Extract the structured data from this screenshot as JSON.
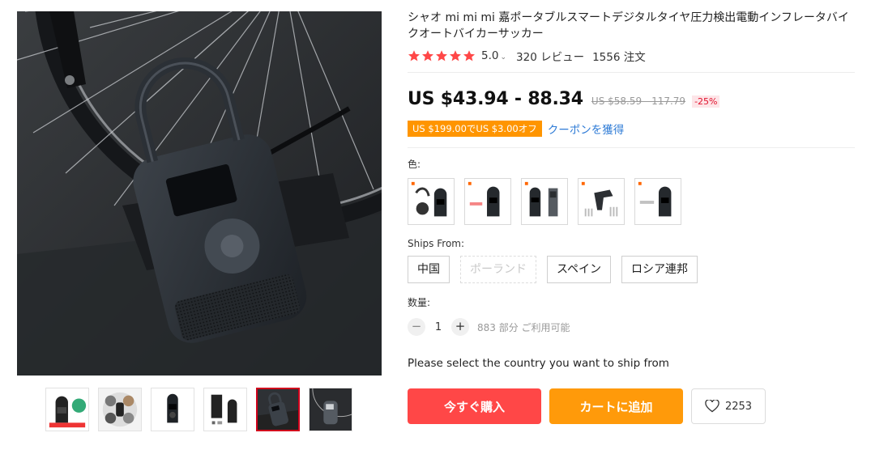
{
  "product": {
    "title": "シャオ mi mi mi 嘉ポータブルスマートデジタルタイヤ圧力検出電動インフレータバイクオートバイカーサッカー",
    "rating": "5.0",
    "reviews": "320 レビュー",
    "orders": "1556 注文",
    "star_color": "#ff4747"
  },
  "price": {
    "current": "US $43.94 - 88.34",
    "original": "US $58.59 - 117.79",
    "discount": "-25%"
  },
  "coupon": {
    "badge": "US $199.00でUS $3.00オフ",
    "link": "クーポンを獲得"
  },
  "color": {
    "label": "色:",
    "options": [
      "pump-with-accessories",
      "pump-with-tag",
      "pump-with-gauge",
      "pump-with-drill-kit",
      "pump-with-label"
    ]
  },
  "ships_from": {
    "label": "Ships From:",
    "options": [
      {
        "label": "中国",
        "disabled": false
      },
      {
        "label": "ポーランド",
        "disabled": true
      },
      {
        "label": "スペイン",
        "disabled": false
      },
      {
        "label": "ロシア連邦",
        "disabled": false
      }
    ]
  },
  "quantity": {
    "label": "数量:",
    "minus": "−",
    "value": "1",
    "plus": "+",
    "stock": "883 部分 ご利用可能"
  },
  "ship_message": "Please select the country you want to ship from",
  "actions": {
    "buy": "今すぐ購入",
    "cart": "カートに追加",
    "wishlist_count": "2253"
  },
  "gallery": {
    "thumbnails": [
      "thumb-1",
      "thumb-2",
      "thumb-3",
      "thumb-4",
      "thumb-5",
      "thumb-6"
    ],
    "active_index": 4
  },
  "colors": {
    "buy": "#ff4747",
    "cart": "#ff9a0a",
    "coupon": "#ff9500",
    "link": "#2e7bd6"
  }
}
